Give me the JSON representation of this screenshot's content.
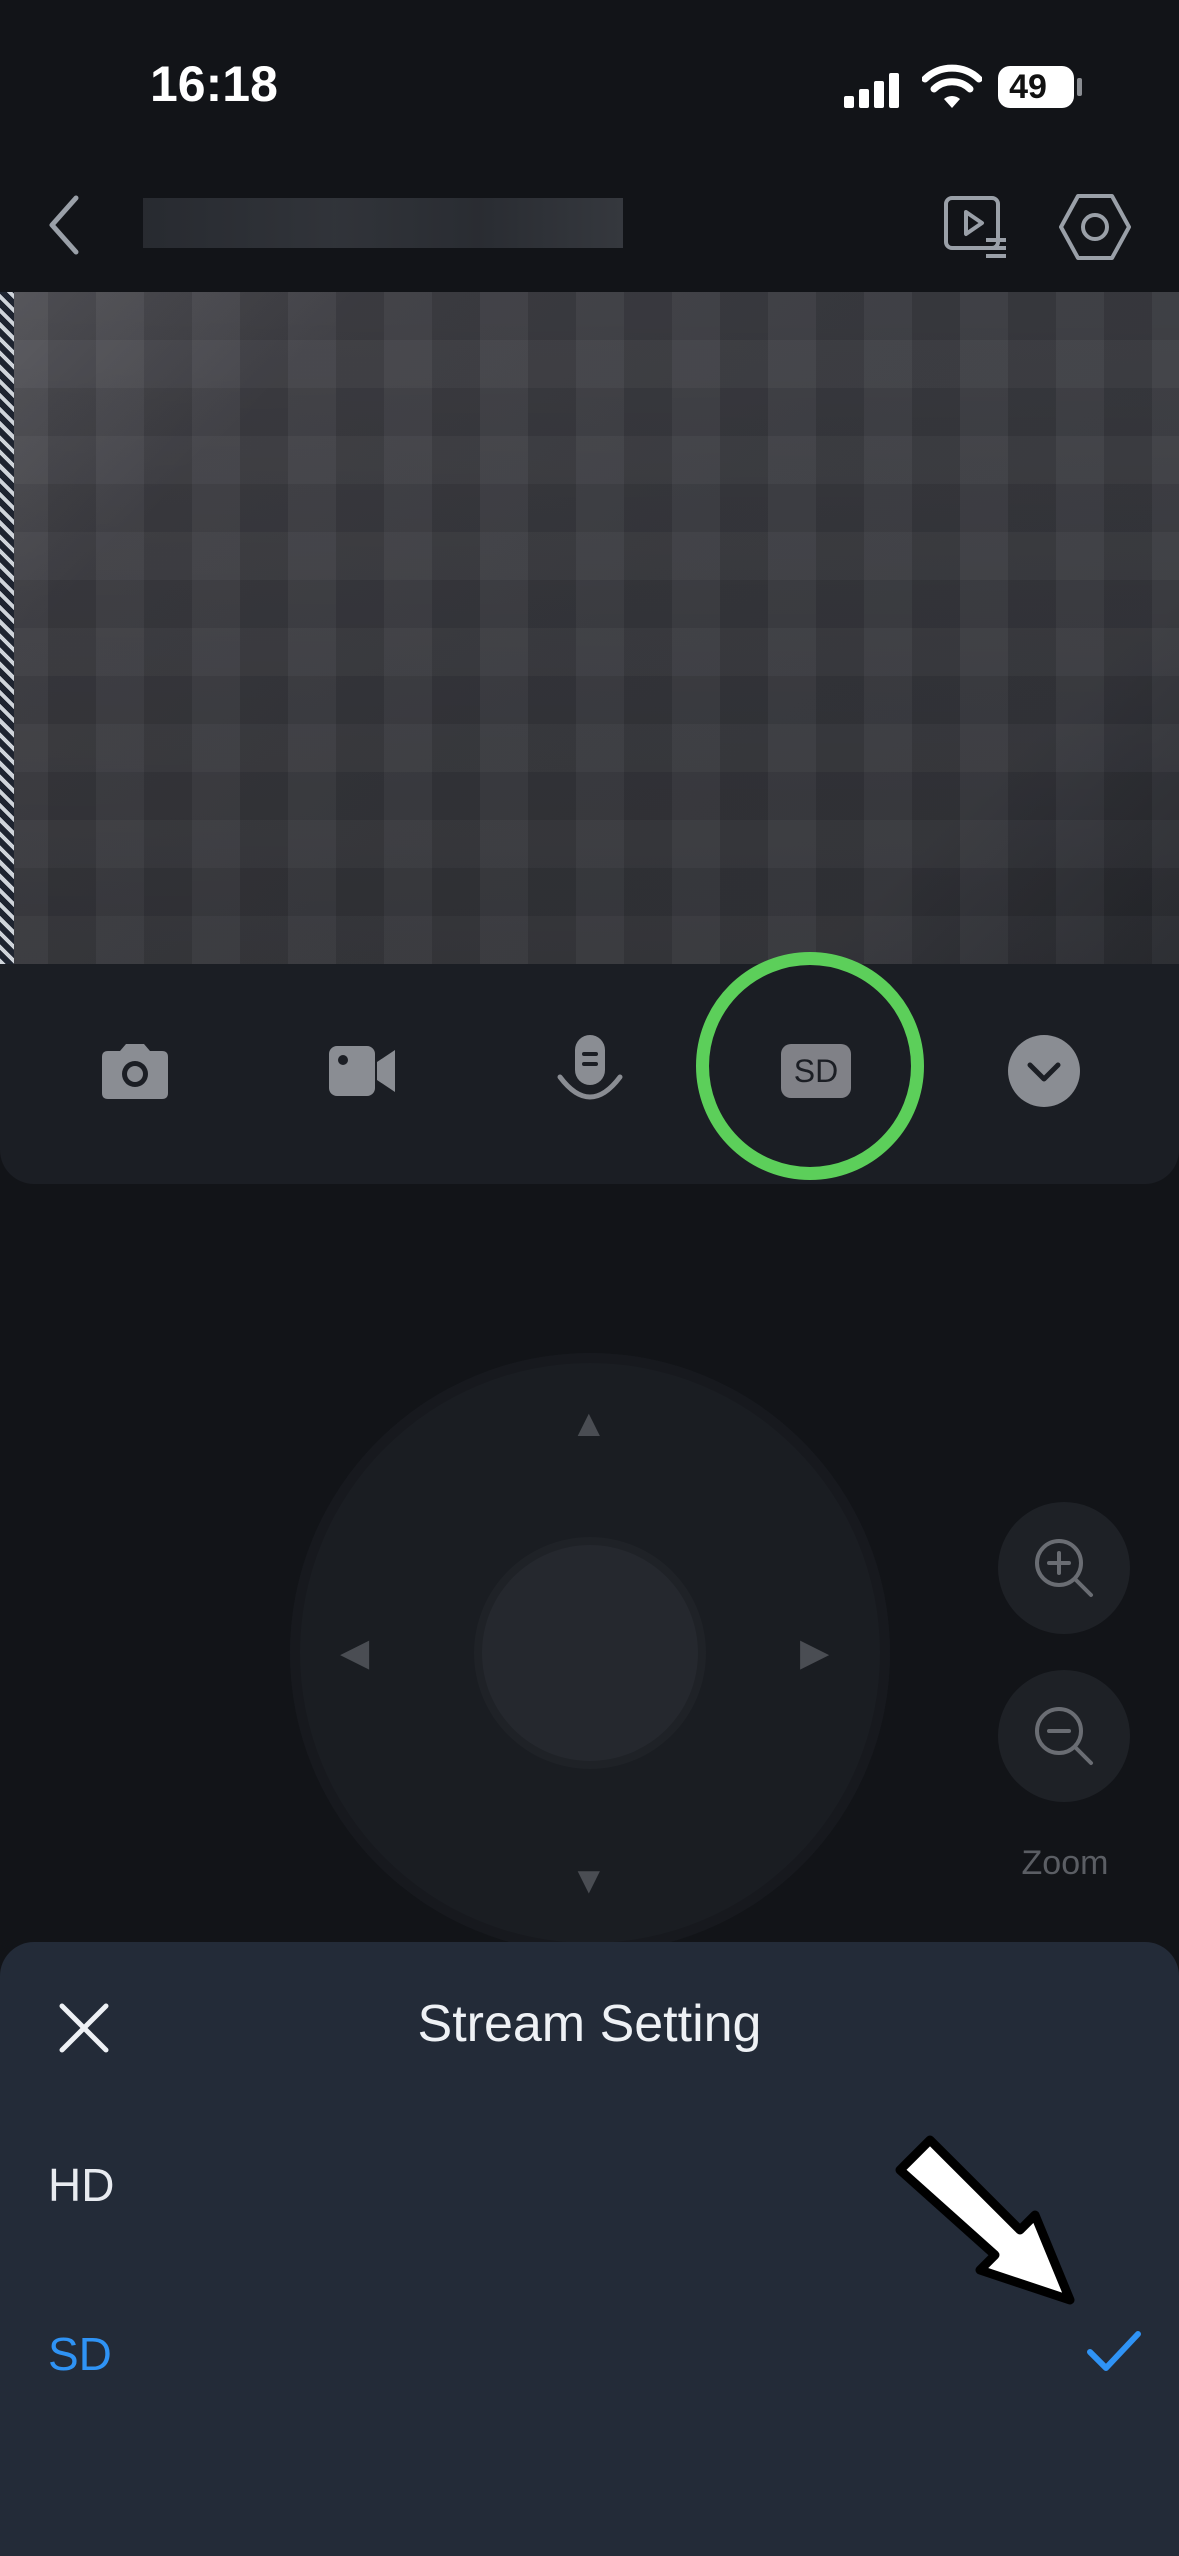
{
  "status_bar": {
    "time": "16:18",
    "battery": "49"
  },
  "header": {
    "back_icon": "chevron-left-icon",
    "playback_icon": "playback-list-icon",
    "settings_icon": "gear-hexagon-icon"
  },
  "toolbar": {
    "items": [
      "camera-icon",
      "video-record-icon",
      "microphone-icon",
      "sd-quality-badge",
      "chevron-down-icon"
    ],
    "quality_label": "SD"
  },
  "ptz": {
    "zoom_label": "Zoom",
    "zoom_in_icon": "zoom-in-icon",
    "zoom_out_icon": "zoom-out-icon"
  },
  "sheet": {
    "title": "Stream Setting",
    "options": [
      {
        "label": "HD",
        "selected": false
      },
      {
        "label": "SD",
        "selected": true
      }
    ],
    "selected_color": "#2f93f5"
  },
  "colors": {
    "highlight": "#5ccf5a",
    "accent": "#2f93f5"
  }
}
